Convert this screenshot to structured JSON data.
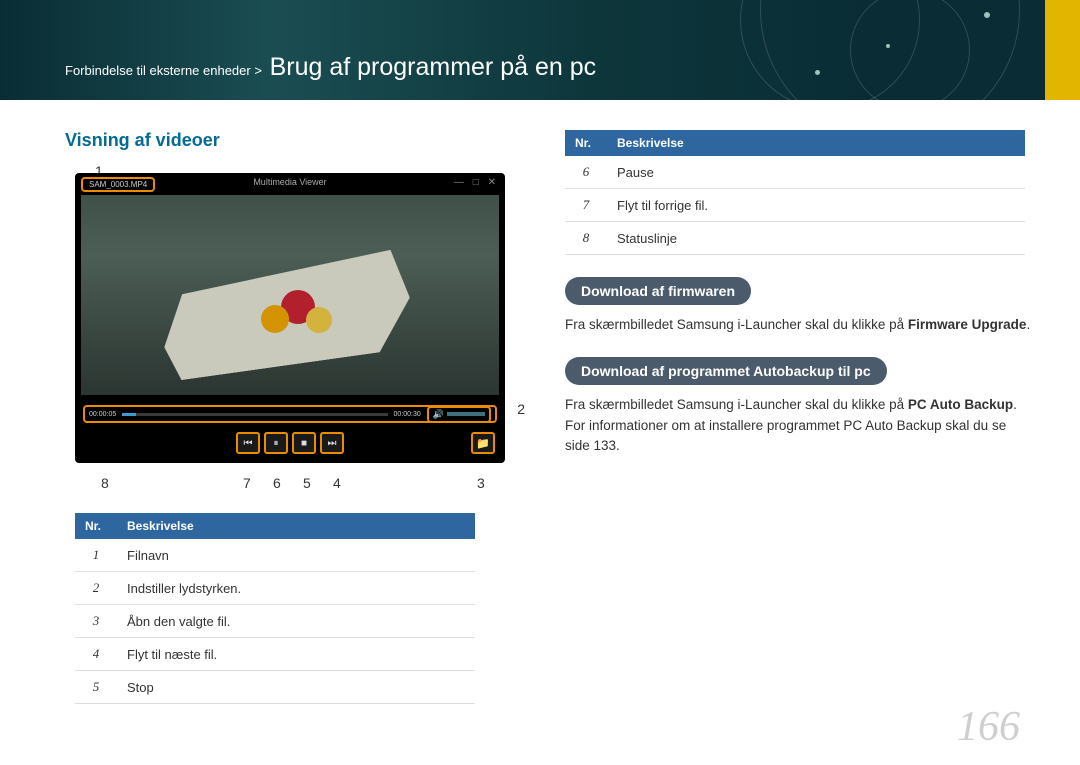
{
  "breadcrumb": {
    "parent": "Forbindelse til eksterne enheder >",
    "title": "Brug af programmer på en pc"
  },
  "section_heading": "Visning af videoer",
  "player": {
    "filename": "SAM_0003.MP4",
    "window_title": "Multimedia Viewer",
    "time_elapsed": "00:00:05",
    "time_total": "00:00:30"
  },
  "callouts": {
    "n1": "1",
    "n2": "2",
    "n3": "3",
    "n4": "4",
    "n5": "5",
    "n6": "6",
    "n7": "7",
    "n8": "8"
  },
  "table_left": {
    "h1": "Nr.",
    "h2": "Beskrivelse",
    "rows": [
      {
        "n": "1",
        "d": "Filnavn"
      },
      {
        "n": "2",
        "d": "Indstiller lydstyrken."
      },
      {
        "n": "3",
        "d": "Åbn den valgte fil."
      },
      {
        "n": "4",
        "d": "Flyt til næste fil."
      },
      {
        "n": "5",
        "d": "Stop"
      }
    ]
  },
  "table_right": {
    "h1": "Nr.",
    "h2": "Beskrivelse",
    "rows": [
      {
        "n": "6",
        "d": "Pause"
      },
      {
        "n": "7",
        "d": "Flyt til forrige fil."
      },
      {
        "n": "8",
        "d": "Statuslinje"
      }
    ]
  },
  "download_fw": {
    "heading": "Download af firmwaren",
    "text_a": "Fra skærmbilledet Samsung i-Launcher skal du klikke på ",
    "bold_a": "Firmware Upgrade",
    "tail_a": "."
  },
  "download_ab": {
    "heading": "Download af programmet Autobackup til pc",
    "text_a": "Fra skærmbilledet Samsung i-Launcher skal du klikke på ",
    "bold_a": "PC Auto Backup",
    "text_b": ". For informationer om at installere programmet PC Auto Backup skal du se side 133."
  },
  "page_number": "166"
}
